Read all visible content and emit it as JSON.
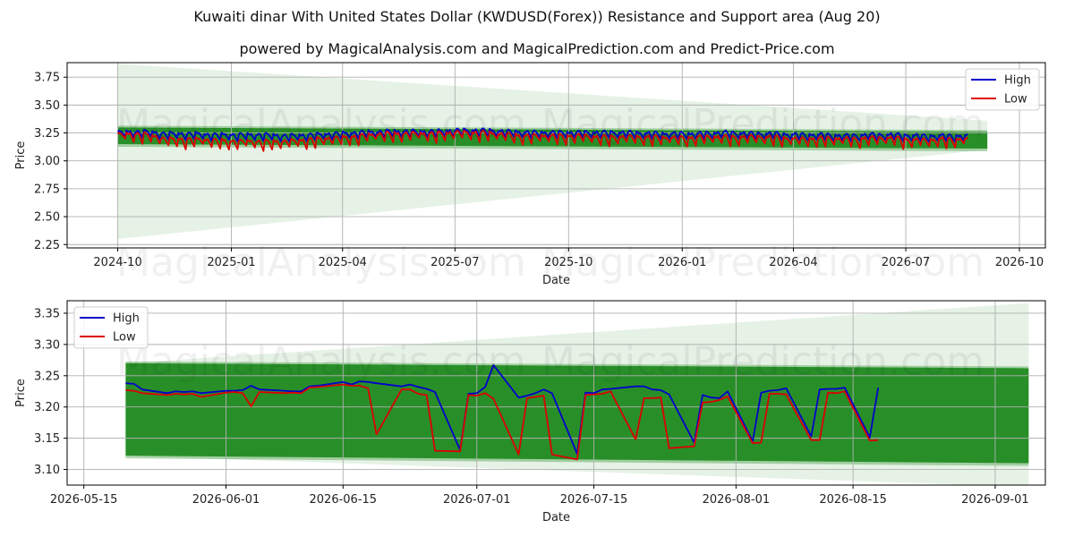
{
  "title": "Kuwaiti dinar With United States Dollar (KWDUSD(Forex)) Resistance and Support area (Aug 20)",
  "subtitle": "powered by MagicalAnalysis.com and MagicalPrediction.com and Predict-Price.com",
  "watermarks": [
    "MagicalAnalysis.com",
    "MagicalPrediction.com"
  ],
  "colors": {
    "high": "#0000cc",
    "low": "#dd0000",
    "band": "#228b22",
    "band_light": "#cfe8cf",
    "grid": "#b0b0b0"
  },
  "chart_data": [
    {
      "type": "line",
      "xlabel": "Date",
      "ylabel": "Price",
      "x_ticks": [
        "2024-10",
        "2025-01",
        "2025-04",
        "2025-07",
        "2025-10",
        "2026-01",
        "2026-04",
        "2026-07",
        "2026-10"
      ],
      "y_ticks": [
        "2.25",
        "2.50",
        "2.75",
        "3.00",
        "3.25",
        "3.50",
        "3.75"
      ],
      "ylim": [
        2.22,
        3.88
      ],
      "xlim": [
        "2024-08-21",
        "2026-10-22"
      ],
      "grid": true,
      "legend": "top-right",
      "series_names": [
        "High",
        "Low"
      ],
      "x_start": "2024-10-01",
      "x_end": "2026-08-20",
      "high_base": [
        3.26,
        3.27,
        3.25,
        3.25,
        3.24,
        3.24,
        3.24,
        3.23,
        3.24,
        3.25,
        3.26,
        3.27,
        3.27,
        3.27,
        3.28,
        3.28,
        3.27,
        3.26,
        3.26,
        3.26,
        3.26,
        3.26,
        3.25,
        3.25,
        3.25,
        3.26,
        3.25,
        3.25,
        3.24,
        3.24,
        3.23,
        3.24,
        3.24,
        3.23,
        3.23,
        3.23
      ],
      "low_base": [
        3.24,
        3.25,
        3.2,
        3.2,
        3.19,
        3.18,
        3.18,
        3.18,
        3.2,
        3.21,
        3.23,
        3.25,
        3.25,
        3.25,
        3.26,
        3.26,
        3.24,
        3.23,
        3.23,
        3.23,
        3.22,
        3.22,
        3.22,
        3.21,
        3.22,
        3.22,
        3.22,
        3.22,
        3.2,
        3.21,
        3.2,
        3.21,
        3.21,
        3.19,
        3.2,
        3.2
      ],
      "band": {
        "x": [
          "2024-10-01",
          "2026-09-05"
        ],
        "upper": [
          3.3,
          3.26
        ],
        "lower": [
          3.15,
          3.11
        ]
      },
      "cone": {
        "x": [
          "2024-10-01",
          "2026-09-05"
        ],
        "upper": [
          3.87,
          3.36
        ],
        "lower": [
          2.3,
          3.1
        ]
      }
    },
    {
      "type": "line",
      "xlabel": "Date",
      "ylabel": "Price",
      "x_ticks": [
        "2026-05-15",
        "2026-06-01",
        "2026-06-15",
        "2026-07-01",
        "2026-07-15",
        "2026-08-01",
        "2026-08-15",
        "2026-09-01"
      ],
      "y_ticks": [
        "3.10",
        "3.15",
        "3.20",
        "3.25",
        "3.30",
        "3.35"
      ],
      "ylim": [
        3.075,
        3.37
      ],
      "xlim": [
        "2026-05-13",
        "2026-09-07"
      ],
      "grid": true,
      "legend": "top-left",
      "series": [
        {
          "name": "High",
          "x": [
            "2026-05-20",
            "2026-05-21",
            "2026-05-22",
            "2026-05-25",
            "2026-05-26",
            "2026-05-27",
            "2026-05-28",
            "2026-05-29",
            "2026-06-01",
            "2026-06-02",
            "2026-06-03",
            "2026-06-04",
            "2026-06-05",
            "2026-06-08",
            "2026-06-09",
            "2026-06-10",
            "2026-06-11",
            "2026-06-12",
            "2026-06-15",
            "2026-06-16",
            "2026-06-17",
            "2026-06-18",
            "2026-06-19",
            "2026-06-22",
            "2026-06-23",
            "2026-06-24",
            "2026-06-25",
            "2026-06-26",
            "2026-06-29",
            "2026-06-30",
            "2026-07-01",
            "2026-07-02",
            "2026-07-03",
            "2026-07-06",
            "2026-07-07",
            "2026-07-08",
            "2026-07-09",
            "2026-07-10",
            "2026-07-13",
            "2026-07-14",
            "2026-07-15",
            "2026-07-16",
            "2026-07-17",
            "2026-07-20",
            "2026-07-21",
            "2026-07-22",
            "2026-07-23",
            "2026-07-24",
            "2026-07-27",
            "2026-07-28",
            "2026-07-29",
            "2026-07-30",
            "2026-07-31",
            "2026-08-03",
            "2026-08-04",
            "2026-08-05",
            "2026-08-06",
            "2026-08-07",
            "2026-08-10",
            "2026-08-11",
            "2026-08-12",
            "2026-08-13",
            "2026-08-14",
            "2026-08-17",
            "2026-08-18"
          ],
          "values": [
            3.238,
            3.237,
            3.228,
            3.222,
            3.225,
            3.224,
            3.225,
            3.222,
            3.226,
            3.226,
            3.227,
            3.234,
            3.228,
            3.226,
            3.225,
            3.225,
            3.233,
            3.234,
            3.24,
            3.236,
            3.241,
            3.24,
            3.238,
            3.233,
            3.236,
            3.232,
            3.229,
            3.224,
            3.131,
            3.221,
            3.222,
            3.232,
            3.267,
            3.215,
            3.218,
            3.222,
            3.228,
            3.222,
            3.125,
            3.223,
            3.222,
            3.228,
            3.229,
            3.233,
            3.233,
            3.228,
            3.227,
            3.22,
            3.143,
            3.219,
            3.215,
            3.214,
            3.225,
            3.145,
            3.223,
            3.226,
            3.227,
            3.23,
            3.153,
            3.228,
            3.229,
            3.229,
            3.231,
            3.151,
            3.231
          ]
        },
        {
          "name": "Low",
          "x": [
            "2026-05-20",
            "2026-05-21",
            "2026-05-22",
            "2026-05-25",
            "2026-05-26",
            "2026-05-27",
            "2026-05-28",
            "2026-05-29",
            "2026-06-01",
            "2026-06-02",
            "2026-06-03",
            "2026-06-04",
            "2026-06-05",
            "2026-06-08",
            "2026-06-09",
            "2026-06-10",
            "2026-06-11",
            "2026-06-12",
            "2026-06-15",
            "2026-06-16",
            "2026-06-17",
            "2026-06-18",
            "2026-06-19",
            "2026-06-22",
            "2026-06-23",
            "2026-06-24",
            "2026-06-25",
            "2026-06-26",
            "2026-06-29",
            "2026-06-30",
            "2026-07-01",
            "2026-07-02",
            "2026-07-03",
            "2026-07-06",
            "2026-07-07",
            "2026-07-08",
            "2026-07-09",
            "2026-07-10",
            "2026-07-13",
            "2026-07-14",
            "2026-07-15",
            "2026-07-16",
            "2026-07-17",
            "2026-07-20",
            "2026-07-21",
            "2026-07-22",
            "2026-07-23",
            "2026-07-24",
            "2026-07-27",
            "2026-07-28",
            "2026-07-29",
            "2026-07-30",
            "2026-07-31",
            "2026-08-03",
            "2026-08-04",
            "2026-08-05",
            "2026-08-06",
            "2026-08-07",
            "2026-08-10",
            "2026-08-11",
            "2026-08-12",
            "2026-08-13",
            "2026-08-14",
            "2026-08-17",
            "2026-08-18"
          ],
          "values": [
            3.227,
            3.226,
            3.222,
            3.219,
            3.221,
            3.22,
            3.221,
            3.216,
            3.223,
            3.224,
            3.222,
            3.201,
            3.224,
            3.222,
            3.223,
            3.222,
            3.231,
            3.232,
            3.236,
            3.234,
            3.234,
            3.23,
            3.156,
            3.228,
            3.228,
            3.221,
            3.219,
            3.13,
            3.129,
            3.219,
            3.218,
            3.222,
            3.213,
            3.124,
            3.214,
            3.216,
            3.218,
            3.124,
            3.116,
            3.219,
            3.22,
            3.221,
            3.225,
            3.148,
            3.214,
            3.214,
            3.215,
            3.134,
            3.137,
            3.207,
            3.208,
            3.211,
            3.217,
            3.142,
            3.143,
            3.221,
            3.221,
            3.22,
            3.147,
            3.147,
            3.223,
            3.222,
            3.225,
            3.146,
            3.147
          ]
        }
      ],
      "band": {
        "x": [
          "2026-05-20",
          "2026-09-05"
        ],
        "upper": [
          3.27,
          3.262
        ],
        "lower": [
          3.122,
          3.11
        ]
      },
      "cone": {
        "x": [
          "2026-05-20",
          "2026-09-05"
        ],
        "upper": [
          3.27,
          3.366
        ],
        "lower": [
          3.122,
          3.072
        ]
      }
    }
  ]
}
